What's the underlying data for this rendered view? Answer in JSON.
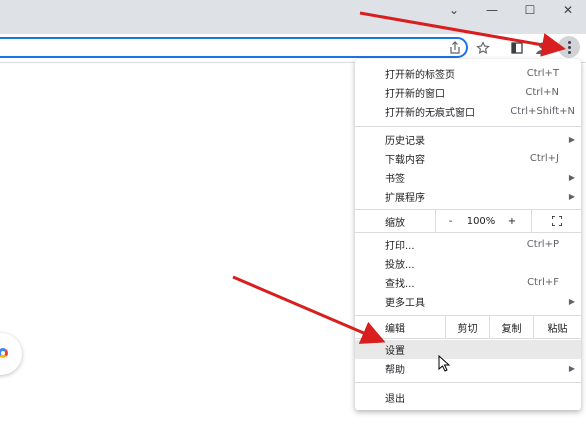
{
  "window_controls": {
    "tabs_dropdown": "⌄",
    "minimize": "—",
    "maximize": "☐",
    "close": "✕"
  },
  "menu": {
    "items_top": [
      {
        "label": "打开新的标签页",
        "shortcut": "Ctrl+T"
      },
      {
        "label": "打开新的窗口",
        "shortcut": "Ctrl+N"
      },
      {
        "label": "打开新的无痕式窗口",
        "shortcut": "Ctrl+Shift+N"
      }
    ],
    "items_mid": [
      {
        "label": "历史记录",
        "shortcut": "",
        "submenu": true
      },
      {
        "label": "下载内容",
        "shortcut": "Ctrl+J",
        "submenu": false
      },
      {
        "label": "书签",
        "shortcut": "",
        "submenu": true
      },
      {
        "label": "扩展程序",
        "shortcut": "",
        "submenu": true
      }
    ],
    "zoom": {
      "label": "缩放",
      "minus": "-",
      "value": "100%",
      "plus": "+",
      "fullscreen_icon": "fullscreen-icon"
    },
    "items_tools": [
      {
        "label": "打印...",
        "shortcut": "Ctrl+P",
        "submenu": false
      },
      {
        "label": "投放...",
        "shortcut": "",
        "submenu": false
      },
      {
        "label": "查找...",
        "shortcut": "Ctrl+F",
        "submenu": false
      },
      {
        "label": "更多工具",
        "shortcut": "",
        "submenu": true
      }
    ],
    "edit": {
      "label": "编辑",
      "cut": "剪切",
      "copy": "复制",
      "paste": "粘贴"
    },
    "items_bottom": [
      {
        "label": "设置",
        "shortcut": "",
        "submenu": false
      },
      {
        "label": "帮助",
        "shortcut": "",
        "submenu": true
      }
    ],
    "exit": {
      "label": "退出"
    }
  },
  "colors": {
    "annotation_arrow": "#d81e1e",
    "omnibox_focus": "#1a73e8",
    "menu_hover": "#e8e8e9"
  }
}
